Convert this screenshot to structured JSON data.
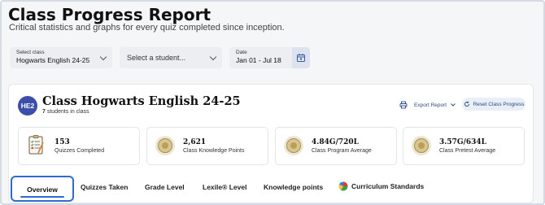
{
  "header": {
    "title": "Class Progress Report",
    "subtitle": "Critical statistics and graphs for every quiz completed since inception."
  },
  "filters": {
    "class_select": {
      "label": "Select class",
      "value": "Hogwarts English 24-25"
    },
    "student_select": {
      "placeholder": "Select a student..."
    },
    "date": {
      "label": "Date",
      "value": "Jan 01 - Jul 18"
    }
  },
  "class_info": {
    "initials": "HE2",
    "title": "Class Hogwarts English 24-25",
    "student_count": "7",
    "student_suffix": "students in class"
  },
  "actions": {
    "export_label": "Export Report",
    "reset_label": "Reset Class Progress"
  },
  "stats": [
    {
      "value": "153",
      "caption": "Quizzes Completed",
      "icon": "quiz-checklist-icon"
    },
    {
      "value": "2,621",
      "caption": "Class Knowledge Points",
      "icon": "coin-icon"
    },
    {
      "value": "4.84G/720L",
      "caption": "Class Program Average",
      "icon": "coin-icon"
    },
    {
      "value": "3.57G/634L",
      "caption": "Class Pretest Average",
      "icon": "coin-icon"
    }
  ],
  "tabs": [
    {
      "label": "Overview",
      "active": true
    },
    {
      "label": "Quizzes Taken"
    },
    {
      "label": "Grade Level"
    },
    {
      "label": "Lexile® Level"
    },
    {
      "label": "Knowledge points"
    },
    {
      "label": "Curriculum Standards",
      "icon": "pie-chart-icon"
    }
  ],
  "colors": {
    "accent": "#2f6ad0",
    "avatar": "#3b4ea8",
    "link": "#2a4a8a"
  }
}
